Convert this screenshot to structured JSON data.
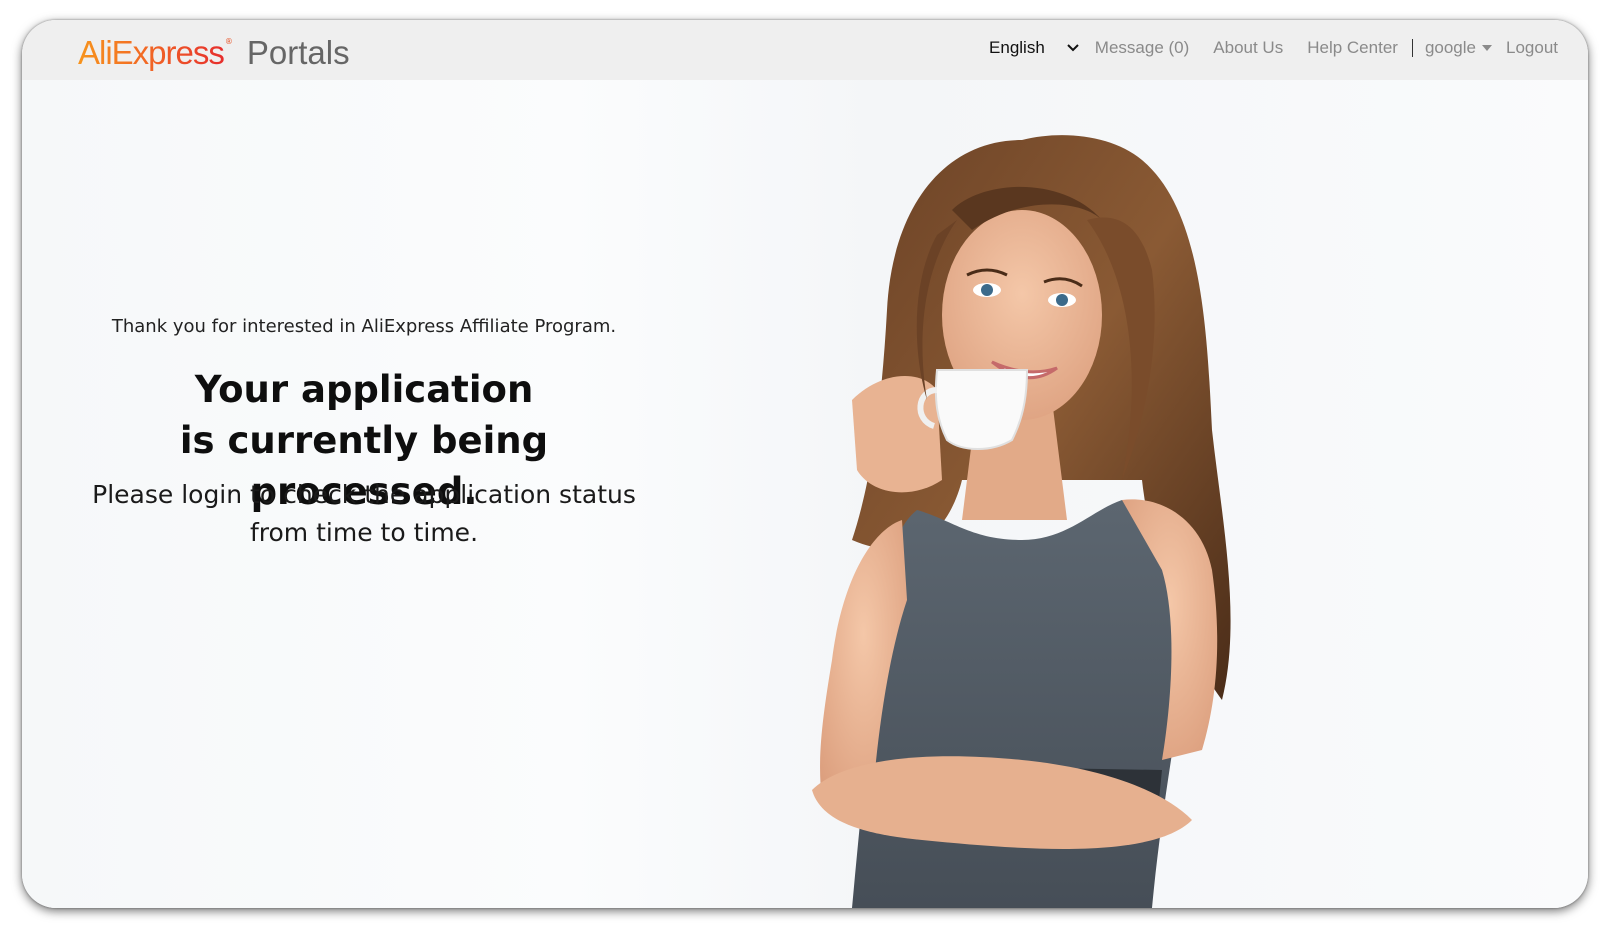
{
  "header": {
    "logo": {
      "brand": "AliExpress",
      "registered": "®",
      "product": "Portals"
    },
    "language": {
      "selected": "English",
      "icon": "chevron-down-icon"
    },
    "nav": {
      "message": "Message (0)",
      "about": "About Us",
      "help": "Help Center",
      "user": "google",
      "logout": "Logout"
    }
  },
  "main": {
    "thanks": "Thank you for interested in AliExpress Affiliate Program.",
    "headline_line1": "Your application",
    "headline_line2": "is currently being processed.",
    "sub_line1": "Please login to check the application status",
    "sub_line2": "from time to time."
  },
  "colors": {
    "header_bg": "#efefef",
    "brand_orange": "#f26a24",
    "brand_red": "#e62e2d",
    "nav_text": "#8a8a8a"
  }
}
